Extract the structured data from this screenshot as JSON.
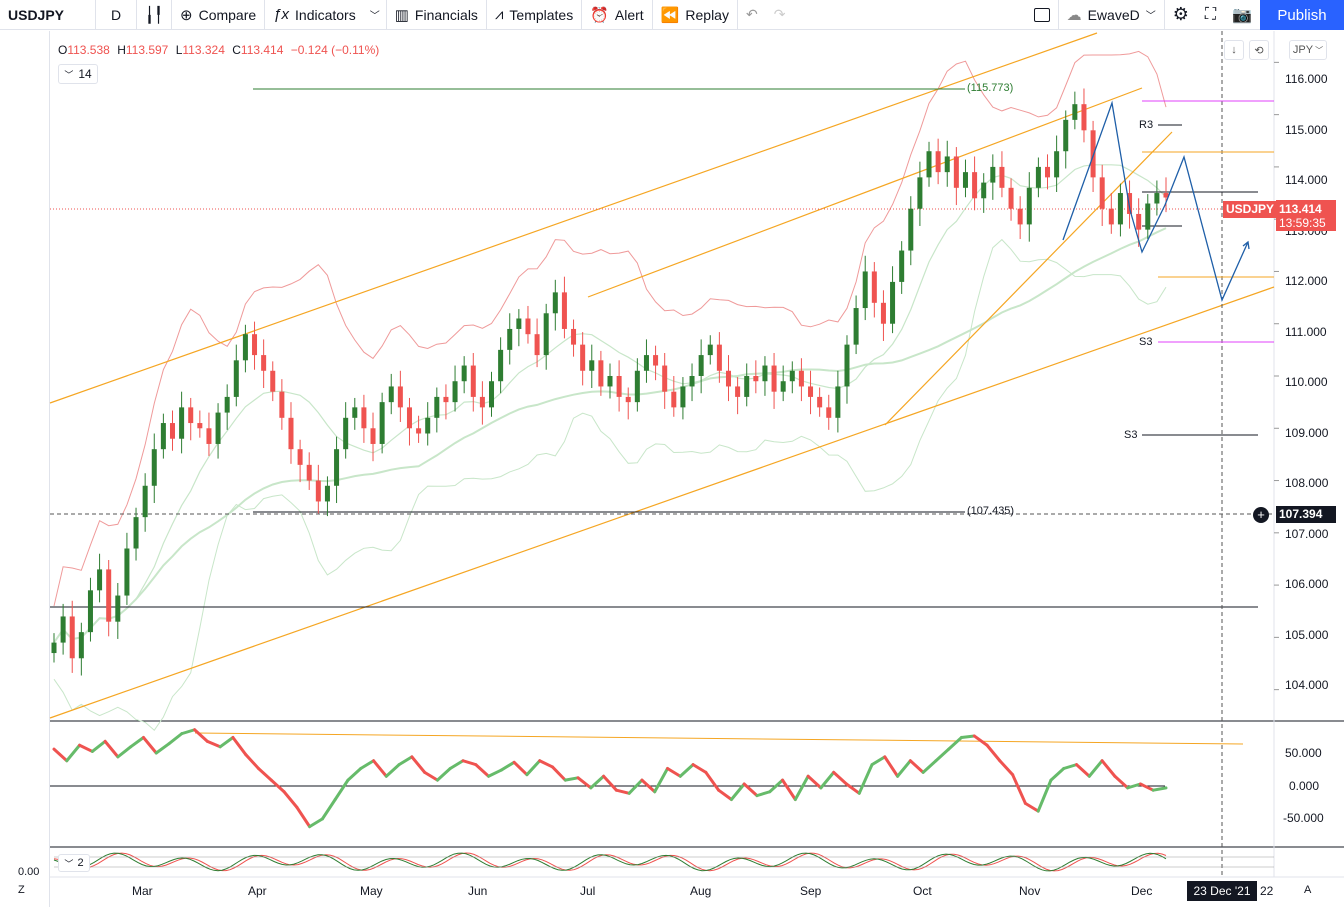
{
  "toolbar": {
    "symbol": "USDJPY",
    "interval": "D",
    "compare": "Compare",
    "indicators": "Indicators",
    "financials": "Financials",
    "templates": "Templates",
    "alert": "Alert",
    "replay": "Replay",
    "user": "EwaveD",
    "publish": "Publish"
  },
  "legend": {
    "open_key": "O",
    "open": "113.538",
    "high_key": "H",
    "high": "113.597",
    "low_key": "L",
    "low": "113.324",
    "close_key": "C",
    "close": "113.414",
    "change": "−0.124 (−0.11%)",
    "indicator_count": "14",
    "lower_indicator_count": "2"
  },
  "price_axis": {
    "currency": "JPY",
    "ticks": [
      "116.000",
      "115.000",
      "114.000",
      "113.000",
      "112.000",
      "111.000",
      "110.000",
      "109.000",
      "108.000",
      "107.000",
      "106.000",
      "105.000",
      "104.000"
    ]
  },
  "osc_axis": {
    "ticks": [
      "50.000",
      "0.000",
      "-50.000"
    ],
    "lower_tick": "0.00"
  },
  "time_axis": {
    "months": [
      "Mar",
      "Apr",
      "May",
      "Jun",
      "Jul",
      "Aug",
      "Sep",
      "Oct",
      "Nov",
      "Dec"
    ],
    "cursor_date": "23 Dec '21",
    "next_year": "22"
  },
  "tags": {
    "symbol": "USDJPY",
    "last_price": "113.414",
    "countdown": "13:59:35",
    "crosshair_price": "107.394"
  },
  "annotations": {
    "high_level": "(115.773)",
    "low_level": "(107.435)",
    "r3": "R3",
    "s3_a": "S3",
    "s3_b": "S3"
  },
  "corner": {
    "left": "Z",
    "right": "A"
  },
  "colors": {
    "up": "#2e7d32",
    "down": "#ef5350",
    "channel": "#f5a623",
    "accent": "#2962ff",
    "wave": "#1f5fa8",
    "bollinger": "#ef9a9a",
    "ma": "#c8e6c9"
  },
  "chart_data": {
    "type": "candlestick",
    "symbol": "USDJPY",
    "interval": "D",
    "ylim": [
      103.4,
      116.6
    ],
    "x_labels": [
      "Mar",
      "Apr",
      "May",
      "Jun",
      "Jul",
      "Aug",
      "Sep",
      "Oct",
      "Nov",
      "Dec"
    ],
    "closes": [
      104.9,
      105.4,
      104.6,
      105.1,
      105.9,
      106.3,
      105.3,
      105.8,
      106.7,
      107.3,
      107.9,
      108.6,
      109.1,
      108.8,
      109.4,
      109.1,
      109.0,
      108.7,
      109.3,
      109.6,
      110.3,
      110.8,
      110.4,
      110.1,
      109.7,
      109.2,
      108.6,
      108.3,
      108.0,
      107.6,
      107.9,
      108.6,
      109.2,
      109.4,
      109.0,
      108.7,
      109.5,
      109.8,
      109.4,
      109.0,
      108.9,
      109.2,
      109.6,
      109.5,
      109.9,
      110.2,
      109.6,
      109.4,
      109.9,
      110.5,
      110.9,
      111.1,
      110.8,
      110.4,
      111.2,
      111.6,
      110.9,
      110.6,
      110.1,
      110.3,
      109.8,
      110.0,
      109.6,
      109.5,
      110.1,
      110.4,
      110.2,
      109.7,
      109.4,
      109.8,
      110.0,
      110.4,
      110.6,
      110.1,
      109.8,
      109.6,
      110.0,
      109.9,
      110.2,
      109.7,
      109.9,
      110.1,
      109.8,
      109.6,
      109.4,
      109.2,
      109.8,
      110.6,
      111.3,
      112.0,
      111.4,
      111.0,
      111.8,
      112.4,
      113.2,
      113.8,
      114.3,
      113.9,
      114.2,
      113.6,
      113.9,
      113.4,
      113.7,
      114.0,
      113.6,
      113.2,
      112.9,
      113.6,
      114.0,
      113.8,
      114.3,
      114.9,
      115.2,
      114.7,
      113.8,
      113.2,
      112.9,
      113.5,
      113.1,
      112.8,
      113.3,
      113.5,
      113.414
    ],
    "oscillator": {
      "name": "",
      "ylim": [
        -80,
        80
      ],
      "values": [
        45,
        30,
        50,
        42,
        55,
        35,
        48,
        60,
        40,
        52,
        65,
        70,
        55,
        48,
        60,
        38,
        20,
        5,
        -10,
        -30,
        -55,
        -45,
        -20,
        5,
        20,
        30,
        10,
        25,
        35,
        15,
        5,
        20,
        30,
        25,
        10,
        18,
        28,
        12,
        30,
        22,
        5,
        8,
        -5,
        10,
        -8,
        -12,
        5,
        -10,
        20,
        10,
        25,
        15,
        -8,
        -20,
        0,
        -15,
        -10,
        5,
        -20,
        10,
        -5,
        15,
        0,
        -12,
        25,
        35,
        10,
        30,
        15,
        30,
        45,
        60,
        62,
        50,
        30,
        12,
        -25,
        -35,
        5,
        20,
        25,
        10,
        30,
        10,
        -5,
        0,
        -8,
        -5
      ]
    }
  }
}
